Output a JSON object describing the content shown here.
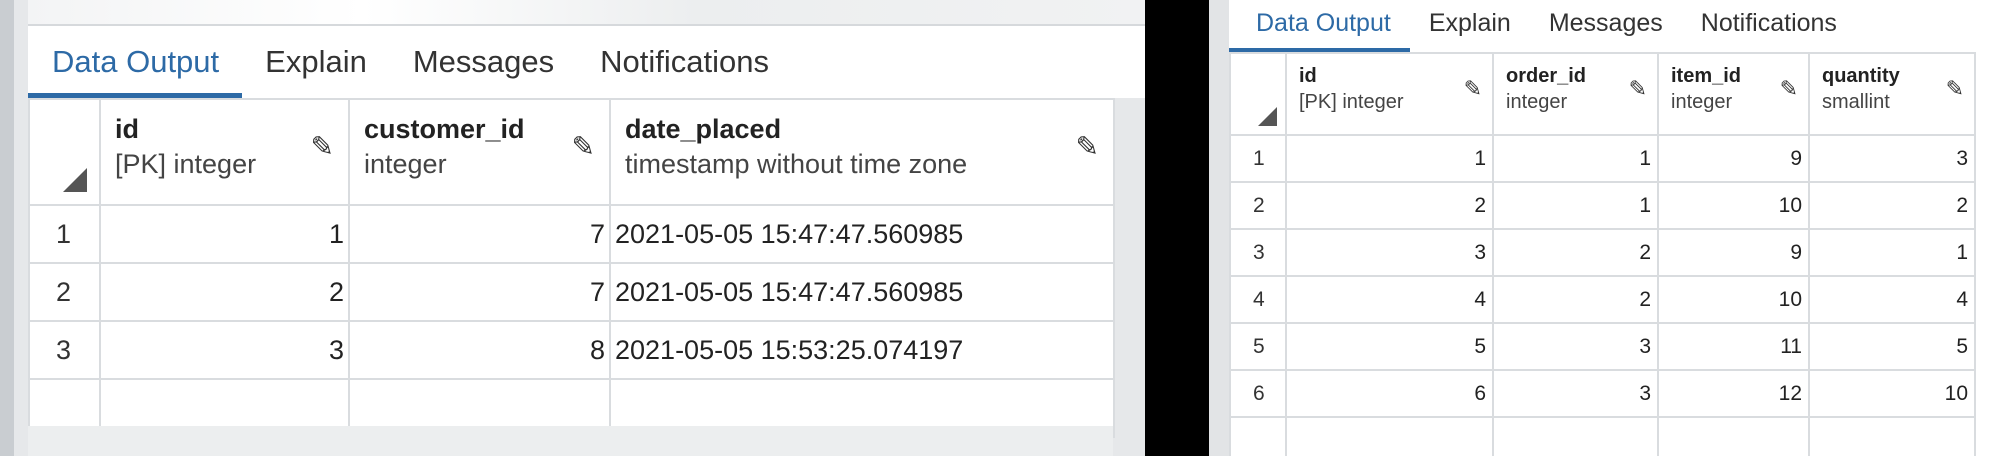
{
  "left": {
    "tabs": [
      "Data Output",
      "Explain",
      "Messages",
      "Notifications"
    ],
    "columns": [
      {
        "name": "id",
        "type": "[PK] integer"
      },
      {
        "name": "customer_id",
        "type": "integer"
      },
      {
        "name": "date_placed",
        "type": "timestamp without time zone"
      }
    ],
    "rows": [
      {
        "n": "1",
        "cells": [
          "1",
          "7",
          "2021-05-05 15:47:47.560985"
        ]
      },
      {
        "n": "2",
        "cells": [
          "2",
          "7",
          "2021-05-05 15:47:47.560985"
        ]
      },
      {
        "n": "3",
        "cells": [
          "3",
          "8",
          "2021-05-05 15:53:25.074197"
        ]
      }
    ]
  },
  "right": {
    "tabs": [
      "Data Output",
      "Explain",
      "Messages",
      "Notifications"
    ],
    "columns": [
      {
        "name": "id",
        "type": "[PK] integer"
      },
      {
        "name": "order_id",
        "type": "integer"
      },
      {
        "name": "item_id",
        "type": "integer"
      },
      {
        "name": "quantity",
        "type": "smallint"
      }
    ],
    "rows": [
      {
        "n": "1",
        "cells": [
          "1",
          "1",
          "9",
          "3"
        ]
      },
      {
        "n": "2",
        "cells": [
          "2",
          "1",
          "10",
          "2"
        ]
      },
      {
        "n": "3",
        "cells": [
          "3",
          "2",
          "9",
          "1"
        ]
      },
      {
        "n": "4",
        "cells": [
          "4",
          "2",
          "10",
          "4"
        ]
      },
      {
        "n": "5",
        "cells": [
          "5",
          "3",
          "11",
          "5"
        ]
      },
      {
        "n": "6",
        "cells": [
          "6",
          "3",
          "12",
          "10"
        ]
      }
    ]
  },
  "icons": {
    "edit": "pencil-icon",
    "select_all": "select-all-corner-icon"
  },
  "colors": {
    "accent": "#2d6aa6",
    "grid_border": "#d9dcdf"
  }
}
